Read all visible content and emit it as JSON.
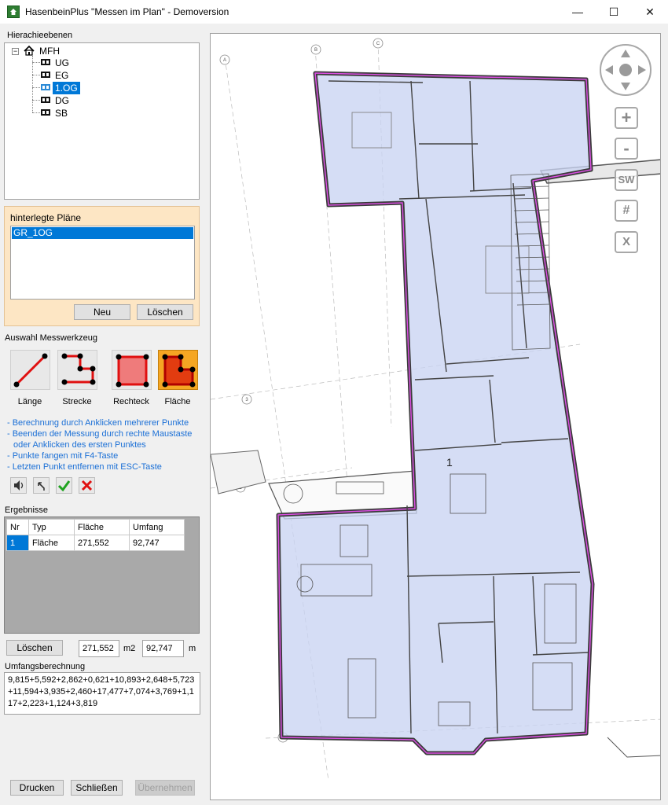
{
  "window": {
    "title": "HasenbeinPlus \"Messen im Plan\" - Demoversion",
    "minimize": "—",
    "maximize": "☐",
    "close": "✕"
  },
  "hierarchy": {
    "label": "Hierachieebenen",
    "root": "MFH",
    "items": [
      "UG",
      "EG",
      "1.OG",
      "DG",
      "SB"
    ],
    "selected_index": 2
  },
  "plans": {
    "label": "hinterlegte Pläne",
    "items": [
      "GR_1OG"
    ],
    "new_button": "Neu",
    "delete_button": "Löschen"
  },
  "tools": {
    "label": "Auswahl Messwerkzeug",
    "items": [
      {
        "label": "Länge",
        "icon": "line-tool-icon"
      },
      {
        "label": "Strecke",
        "icon": "polyline-tool-icon"
      },
      {
        "label": "Rechteck",
        "icon": "rectangle-tool-icon"
      },
      {
        "label": "Fläche",
        "icon": "polygon-area-tool-icon"
      }
    ],
    "active_index": 3,
    "accent_color": "#f5a623"
  },
  "hints": [
    "- Berechnung durch Anklicken mehrerer Punkte",
    "- Beenden der Messung durch rechte Maustaste",
    "   oder Anklicken des ersten Punktes",
    "- Punkte fangen mit  F4-Taste",
    "- Letzten Punkt entfernen mit ESC-Taste"
  ],
  "actions": {
    "sound": "speaker-icon",
    "undo": "undo-icon",
    "ok": "checkmark-icon",
    "cancel": "cross-icon"
  },
  "results": {
    "label": "Ergebnisse",
    "columns": [
      "Nr",
      "Typ",
      "Fläche",
      "Umfang"
    ],
    "rows": [
      {
        "nr": "1",
        "typ": "Fläche",
        "flaeche": "271,552",
        "umfang": "92,747"
      }
    ],
    "delete_button": "Löschen",
    "area_value": "271,552",
    "area_unit": "m2",
    "perimeter_value": "92,747",
    "perimeter_unit": "m"
  },
  "perimeter_calc": {
    "label": "Umfangsberechnung",
    "text": "9,815+5,592+2,862+0,621+10,893+2,648+5,723+11,594+3,935+2,460+17,477+7,074+3,769+1,117+2,223+1,124+3,819"
  },
  "footer": {
    "print_button": "Drucken",
    "close_button": "Schließen",
    "apply_button": "Übernehmen"
  },
  "plan_controls": {
    "zoom_in": "+",
    "zoom_out": "-",
    "sw": "SW",
    "grid": "#",
    "x": "X"
  },
  "plan_labels": {
    "grid_a": "A",
    "grid_b": "B",
    "grid_c": "C",
    "grid_1": "1",
    "grid_2": "2",
    "grid_3": "3",
    "marker": "1"
  }
}
